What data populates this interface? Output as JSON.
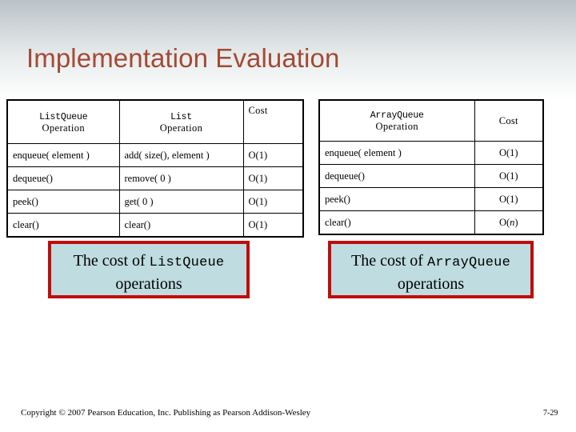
{
  "slide": {
    "title": "Implementation Evaluation",
    "title_color": "#a34a35",
    "background_top_color": "#b9c2c6",
    "background_bottom_color": "#ffffff"
  },
  "table_left": {
    "name": "listqueue-cost-table",
    "headers": {
      "col1_line1": "ListQueue",
      "col1_line2": "Operation",
      "col2_line1": "List",
      "col2_line2": "Operation",
      "col3": "Cost"
    },
    "rows": [
      {
        "queue_op": "enqueue( element )",
        "list_op": "add( size(), element )",
        "cost": "O(1)"
      },
      {
        "queue_op": "dequeue()",
        "list_op": "remove( 0 )",
        "cost": "O(1)"
      },
      {
        "queue_op": "peek()",
        "list_op": "get( 0 )",
        "cost": "O(1)"
      },
      {
        "queue_op": "clear()",
        "list_op": "clear()",
        "cost": "O(1)"
      }
    ]
  },
  "table_right": {
    "name": "arrayqueue-cost-table",
    "headers": {
      "col1_line1": "ArrayQueue",
      "col1_line2": "Operation",
      "col2": "Cost"
    },
    "rows": [
      {
        "queue_op": "enqueue( element )",
        "cost_prefix": "O(1)",
        "cost_italic": "",
        "cost_suffix": ""
      },
      {
        "queue_op": "dequeue()",
        "cost_prefix": "O(1)",
        "cost_italic": "",
        "cost_suffix": ""
      },
      {
        "queue_op": "peek()",
        "cost_prefix": "O(1)",
        "cost_italic": "",
        "cost_suffix": ""
      },
      {
        "queue_op": "clear()",
        "cost_prefix": "O(",
        "cost_italic": "n",
        "cost_suffix": ")"
      }
    ]
  },
  "callouts": {
    "fill_color": "#bfdce0",
    "border_color": "#c00c0c",
    "left": {
      "text_prefix": "The cost of ",
      "code": "ListQueue",
      "text_suffix": "operations"
    },
    "right": {
      "text_prefix": "The cost of ",
      "code": "ArrayQueue",
      "text_suffix": "operations"
    }
  },
  "footer": {
    "copyright": "Copyright © 2007 Pearson Education, Inc. Publishing as Pearson Addison-Wesley",
    "page_number": "7-29"
  }
}
